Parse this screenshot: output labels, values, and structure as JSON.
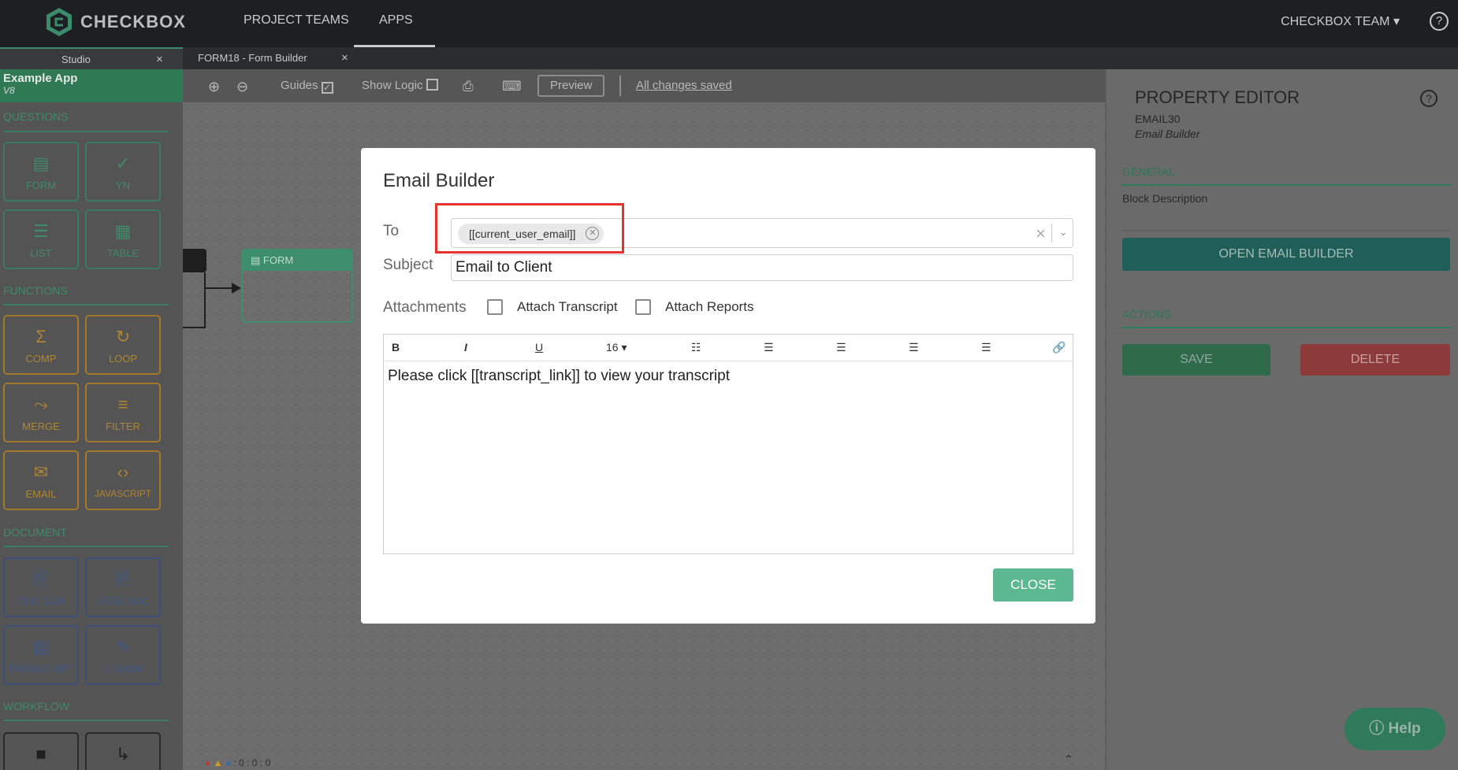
{
  "topbar": {
    "logo_text": "CHECKBOX",
    "nav": [
      "PROJECT TEAMS",
      "APPS"
    ],
    "team_label": "CHECKBOX TEAM",
    "help": "?"
  },
  "tabs": [
    {
      "label": "Studio",
      "close": "×"
    },
    {
      "label": "FORM18 - Form Builder",
      "close": "×"
    }
  ],
  "sidebar": {
    "app_title": "Example App",
    "app_version": "V8",
    "sections": {
      "questions": "QUESTIONS",
      "functions": "FUNCTIONS",
      "document": "DOCUMENT",
      "workflow": "WORKFLOW"
    },
    "tiles": {
      "form": "FORM",
      "yn": "YN",
      "list": "LIST",
      "table": "TABLE",
      "comp": "COMP",
      "loop": "LOOP",
      "merge": "MERGE",
      "filter": "FILTER",
      "email": "EMAIL",
      "javascript": "JAVASCRIPT",
      "doc_gen": "DOC GEN",
      "view_doc": "VIEW DOC",
      "transcript": "TRANSCRIPT",
      "e_sign": "E-SIGN"
    }
  },
  "toolbar": {
    "guides": "Guides",
    "show_logic": "Show Logic",
    "preview": "Preview",
    "saved": "All changes saved"
  },
  "canvas": {
    "node_form": "FORM",
    "stats": ": 0   : 0   : 0"
  },
  "property_editor": {
    "title": "PROPERTY EDITOR",
    "block_id": "EMAIL30",
    "block_type": "Email Builder",
    "general": "GENERAL",
    "block_description": "Block Description",
    "open_email_builder": "OPEN EMAIL BUILDER",
    "actions": "ACTIONS",
    "save": "SAVE",
    "delete": "DELETE"
  },
  "help_bubble": "Help",
  "modal": {
    "title": "Email Builder",
    "to_label": "To",
    "to_chip": "[[current_user_email]]",
    "subject_label": "Subject",
    "subject_value": "Email to Client",
    "attachments_label": "Attachments",
    "attach_transcript": "Attach Transcript",
    "attach_reports": "Attach Reports",
    "font_size": "16",
    "body": "Please click [[transcript_link]] to view your transcript",
    "close": "CLOSE"
  }
}
